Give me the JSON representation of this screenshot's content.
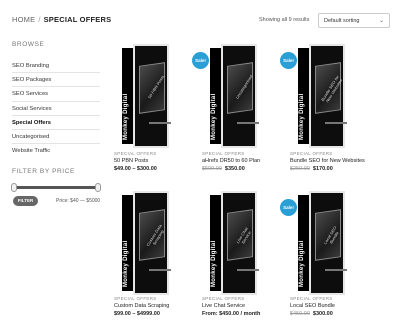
{
  "breadcrumb": {
    "home": "HOME",
    "separator": "/",
    "current": "SPECIAL OFFERS"
  },
  "toolbar": {
    "result_count": "Showing all 9 results",
    "sort_selected": "Default sorting",
    "sort_chevron": "⌄"
  },
  "sidebar": {
    "browse_heading": "BROWSE",
    "items": [
      {
        "label": "SEO Branding"
      },
      {
        "label": "SEO Packages"
      },
      {
        "label": "SEO Services"
      },
      {
        "label": "Social Services"
      },
      {
        "label": "Special Offers",
        "active": true
      },
      {
        "label": "Uncategorised"
      },
      {
        "label": "Website Traffic"
      }
    ],
    "filter_heading": "FILTER BY PRICE",
    "filter_button": "FILTER",
    "price_range": "Price: $40 — $5000"
  },
  "products": [
    {
      "category": "SPECIAL OFFERS",
      "title": "50 PBN Posts",
      "price_old": "",
      "price": "$49.00 – $300.00",
      "sale": false,
      "box_text": "50 PBN Posts",
      "brand": "Monkey Digital"
    },
    {
      "category": "SPECIAL OFFERS",
      "title": "aHrefs DR50 to 60 Plan",
      "price_old": "$500.00",
      "price": "$350.00",
      "sale": true,
      "box_text": "Uncategorized",
      "brand": "Monkey Digital"
    },
    {
      "category": "SPECIAL OFFERS",
      "title": "Bundle SEO for New Websites",
      "price_old": "$250.00",
      "price": "$170.00",
      "sale": true,
      "box_text": "Bundle SEO for New Websites",
      "brand": "Monkey Digital"
    },
    {
      "category": "SPECIAL OFFERS",
      "title": "Custom Data Scraping",
      "price_old": "",
      "price": "$99.00 – $4999.00",
      "sale": false,
      "box_text": "Custom Data Scraping",
      "brand": "Monkey Digital"
    },
    {
      "category": "SPECIAL OFFERS",
      "title": "Live Chat Service",
      "price_old": "",
      "price": "From: $450.00 / month",
      "sale": false,
      "box_text": "Live Chat Service",
      "brand": "Monkey Digital"
    },
    {
      "category": "SPECIAL OFFERS",
      "title": "Local SEO Bundle",
      "price_old": "$450.00",
      "price": "$300.00",
      "sale": true,
      "box_text": "Local SEO Bundle",
      "brand": "Monkey Digital"
    }
  ],
  "sale_label": "Sale!",
  "colors": {
    "sale_badge": "#2a9fd6",
    "filter_button": "#666666",
    "box": "#0d0d0d"
  }
}
